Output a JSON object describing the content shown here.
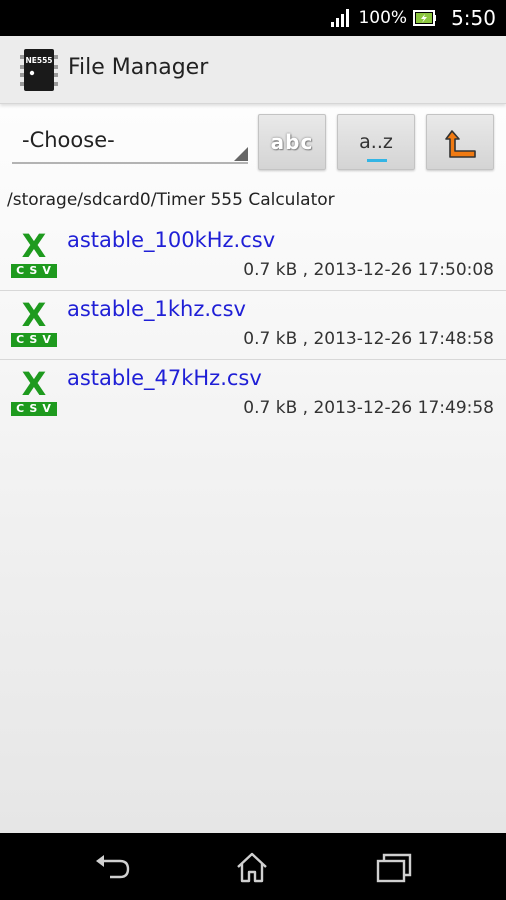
{
  "status_bar": {
    "battery_percent": "100%",
    "time": "5:50"
  },
  "app": {
    "icon_label": "NE555",
    "title": "File Manager"
  },
  "toolbar": {
    "spinner_value": "-Choose-",
    "sort_name_label": "abc",
    "sort_alpha_label": "a..z"
  },
  "path": "/storage/sdcard0/Timer 555 Calculator",
  "files": [
    {
      "name": "astable_100kHz.csv",
      "meta": "0.7 kB , 2013-12-26 17:50:08",
      "icon_text": "X",
      "icon_band": "CSV"
    },
    {
      "name": "astable_1khz.csv",
      "meta": "0.7 kB , 2013-12-26 17:48:58",
      "icon_text": "X",
      "icon_band": "CSV"
    },
    {
      "name": "astable_47kHz.csv",
      "meta": "0.7 kB , 2013-12-26 17:49:58",
      "icon_text": "X",
      "icon_band": "CSV"
    }
  ],
  "icons": {
    "signal": "signal-icon",
    "battery": "battery-charging-icon",
    "up": "folder-up-icon",
    "back": "back-icon",
    "home": "home-icon",
    "recent": "recent-apps-icon"
  },
  "colors": {
    "link": "#1f1fd6",
    "csv_green": "#1e9a1e",
    "accent": "#33b5e5",
    "up_orange": "#f07a12"
  }
}
